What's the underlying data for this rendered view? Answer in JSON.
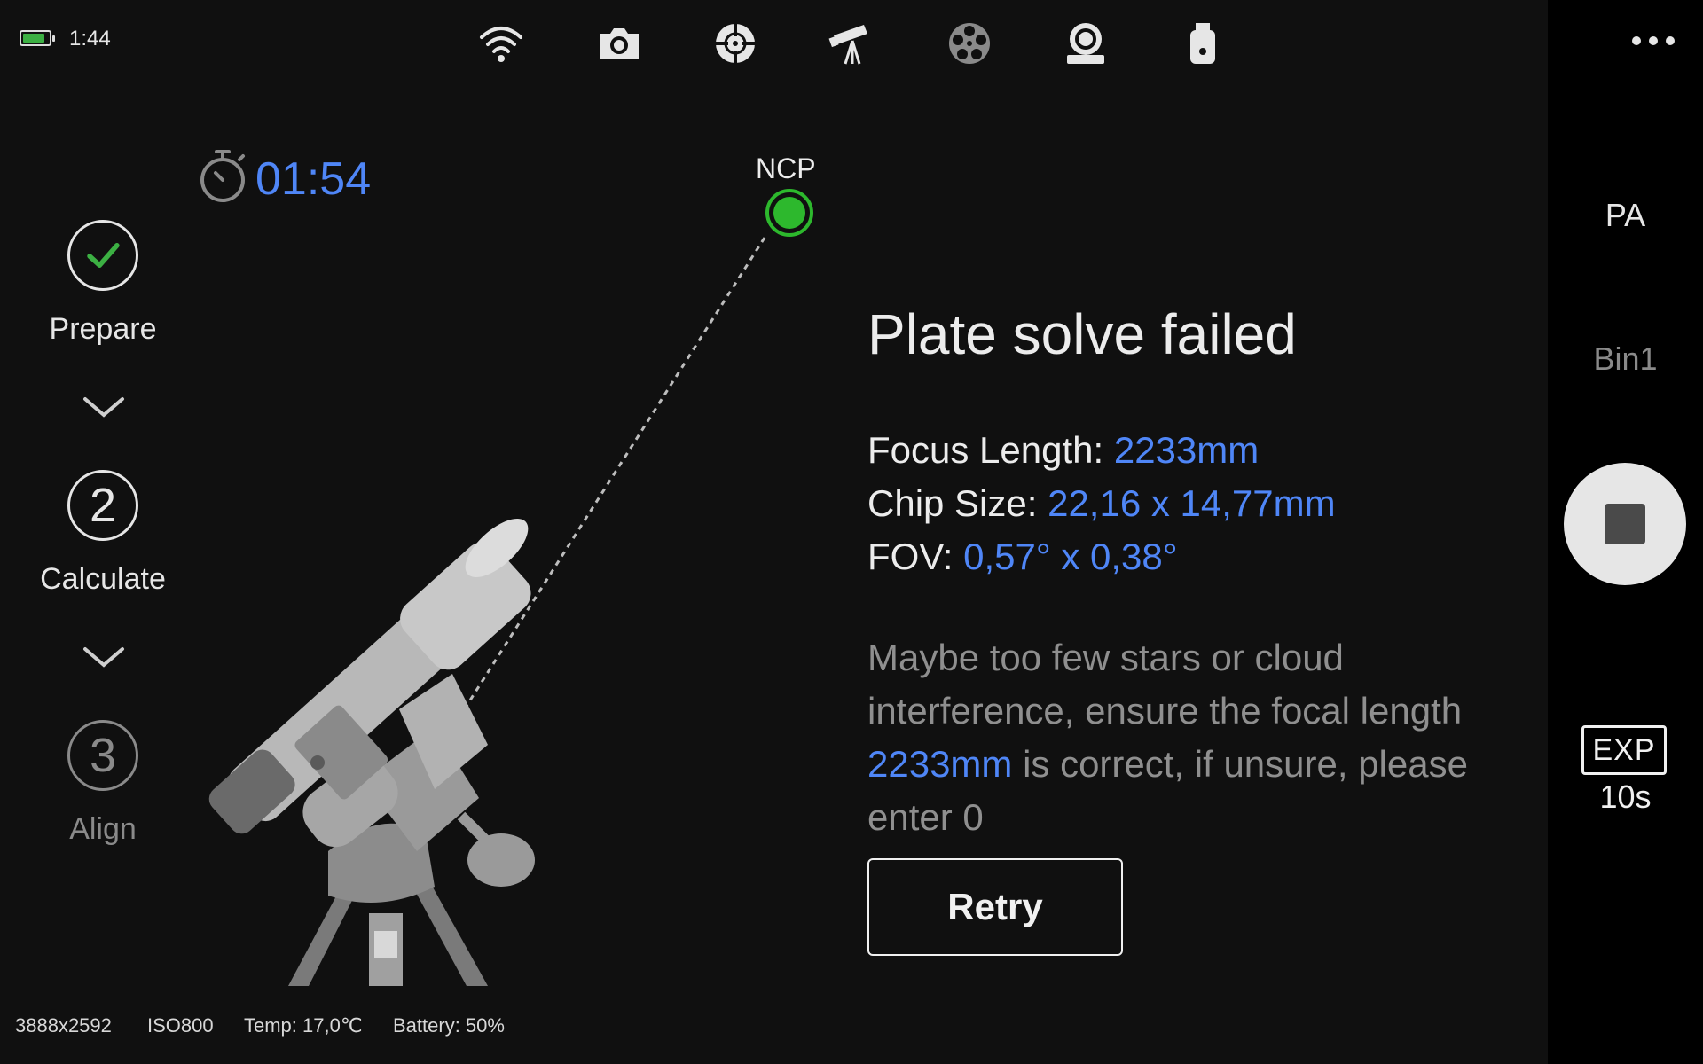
{
  "status_bar": {
    "battery_level": 0.85,
    "battery_color": "#3cb043",
    "time": "1:44",
    "icons": [
      "wifi-icon",
      "camera-icon",
      "focus-target-icon",
      "telescope-icon",
      "filter-wheel-icon",
      "focuser-icon",
      "usb-drive-icon"
    ]
  },
  "right_panel": {
    "mode": "PA",
    "binning": "Bin1",
    "exposure_label": "EXP",
    "exposure_value": "10s"
  },
  "steps": [
    {
      "number": "",
      "label": "Prepare",
      "state": "done"
    },
    {
      "number": "2",
      "label": "Calculate",
      "state": "active"
    },
    {
      "number": "3",
      "label": "Align",
      "state": "pending"
    }
  ],
  "timer": "01:54",
  "scene": {
    "pole_label": "NCP",
    "pole_color": "#2db82d"
  },
  "result": {
    "title": "Plate solve failed",
    "focus_length_label": "Focus Length: ",
    "focus_length_value": "2233mm",
    "chip_size_label": "Chip Size: ",
    "chip_size_value": "22,16 x 14,77mm",
    "fov_label": "FOV: ",
    "fov_value": "0,57° x 0,38°",
    "message_before": "Maybe too few stars or cloud interference, ensure the focal length ",
    "message_highlight": "2233mm",
    "message_after": " is correct, if unsure, please enter 0",
    "retry_label": "Retry"
  },
  "bottom_info": {
    "resolution": "3888x2592",
    "iso": "ISO800",
    "temperature": "Temp: 17,0℃",
    "battery": "Battery: 50%"
  },
  "colors": {
    "accent": "#4f86f7",
    "background": "#101010",
    "done": "#3cb043"
  }
}
